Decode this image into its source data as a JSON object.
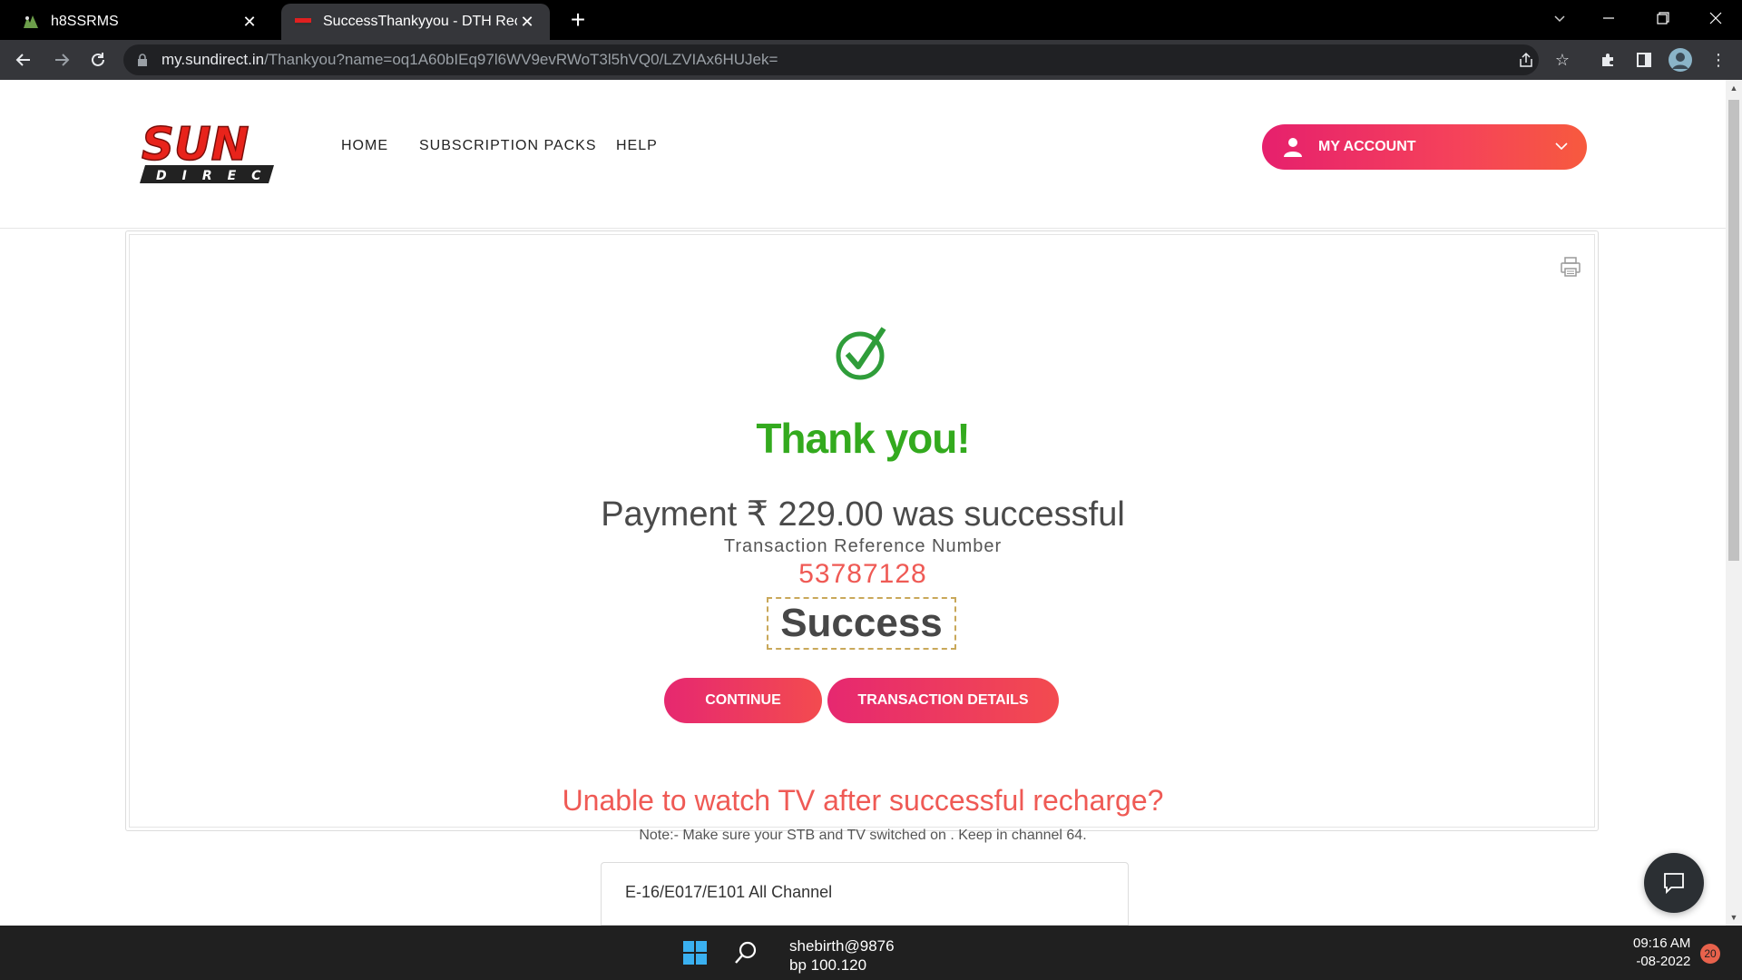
{
  "browser": {
    "tabs": [
      {
        "title": "h8SSRMS",
        "active": false
      },
      {
        "title": "SuccessThankyyou - DTH Recharge",
        "active": true
      }
    ],
    "new_tab": "+",
    "url_host": "my.sundirect.in",
    "url_path": "/Thankyou?name=oq1A60bIEq97l6WV9evRWoT3l5hVQ0/LZVIAx6HUJek="
  },
  "site": {
    "logo_text": "SUN",
    "logo_subtext": "DIRECT",
    "nav": [
      "HOME",
      "SUBSCRIPTION PACKS",
      "HELP"
    ],
    "account_label": "MY ACCOUNT"
  },
  "result": {
    "heading": "Thank you!",
    "payment_message": "Payment ₹ 229.00 was successful",
    "ref_label": "Transaction Reference Number",
    "ref_number": "53787128",
    "status": "Success",
    "continue_label": "CONTINUE",
    "details_label": "TRANSACTION DETAILS"
  },
  "help": {
    "title": "Unable to watch TV after successful recharge?",
    "note": "Note:- Make sure your STB and TV switched on . Keep in channel 64.",
    "faq_item": "E-16/E017/E101 All Channel"
  },
  "taskbar": {
    "weather_line1": "shebirth@9876",
    "weather_line2": "bp 100.120",
    "time": "09:16 AM",
    "date": "-08-2022",
    "badge": "20"
  },
  "colors": {
    "accent_pink": "#e6206d",
    "success_green": "#33aa1e",
    "ref_red": "#ef5a55"
  }
}
